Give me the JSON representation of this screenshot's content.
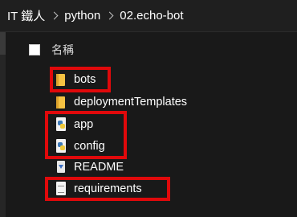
{
  "breadcrumb": {
    "items": [
      "IT 鐵人",
      "python",
      "02.echo-bot"
    ]
  },
  "header": {
    "name_column": "名稱"
  },
  "files": [
    {
      "name": "bots",
      "icon": "folder-icon"
    },
    {
      "name": "deploymentTemplates",
      "icon": "folder-icon"
    },
    {
      "name": "app",
      "icon": "python-file-icon"
    },
    {
      "name": "config",
      "icon": "python-file-icon"
    },
    {
      "name": "README",
      "icon": "markdown-file-icon"
    },
    {
      "name": "requirements",
      "icon": "text-file-icon"
    }
  ],
  "colors": {
    "background": "#191919",
    "highlight": "#e0090b",
    "folder": "#f5c242"
  }
}
